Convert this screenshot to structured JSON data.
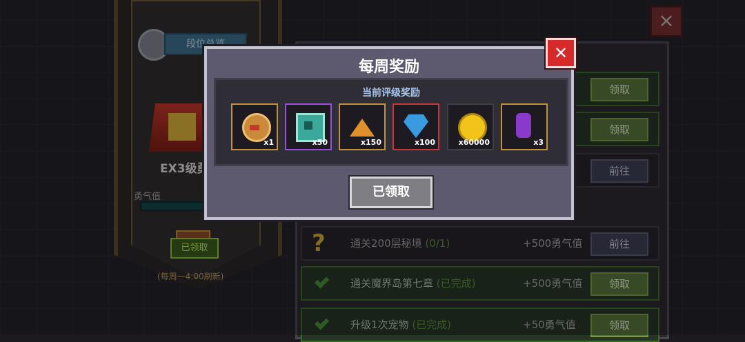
{
  "background": {
    "rank_overview_label": "段位总览",
    "rank_level": "EX3级勇",
    "courage_label": "勇气值",
    "claimed_small_label": "已领取",
    "refresh_note": "(每周一4:00刷新)",
    "close_icon": "×"
  },
  "tasks": [
    {
      "title": "",
      "status": "",
      "points": "",
      "button": "领取",
      "style": "green",
      "icon": "check-icon"
    },
    {
      "title": "",
      "status": "",
      "points": "",
      "button": "领取",
      "style": "green",
      "icon": "check-icon"
    },
    {
      "title": "",
      "status": "",
      "points": "",
      "button": "前往",
      "style": "plain",
      "icon": "question-icon"
    },
    {
      "title": "通关200层秘境",
      "status": "(0/1)",
      "points": "+500勇气值",
      "button": "前往",
      "style": "plain",
      "icon": "question-icon"
    },
    {
      "title": "通关魔界岛第七章",
      "status": "(已完成)",
      "points": "+500勇气值",
      "button": "领取",
      "style": "green",
      "icon": "check-icon"
    },
    {
      "title": "升级1次宠物",
      "status": "(已完成)",
      "points": "+50勇气值",
      "button": "领取",
      "style": "green",
      "icon": "check-icon"
    }
  ],
  "modal": {
    "title": "每周奖励",
    "subtitle": "当前评级奖励",
    "close_icon": "✕",
    "claimed_button": "已领取",
    "items": [
      {
        "icon": "monster-face-icon",
        "qty": "x1",
        "rarity": "gold"
      },
      {
        "icon": "green-gem-icon",
        "qty": "x50",
        "rarity": "purple"
      },
      {
        "icon": "ore-pile-icon",
        "qty": "x150",
        "rarity": "gold"
      },
      {
        "icon": "blue-diamond-icon",
        "qty": "x100",
        "rarity": "red"
      },
      {
        "icon": "gold-coin-icon",
        "qty": "x60000",
        "rarity": "dark"
      },
      {
        "icon": "purple-potion-icon",
        "qty": "x3",
        "rarity": "gold"
      }
    ]
  }
}
